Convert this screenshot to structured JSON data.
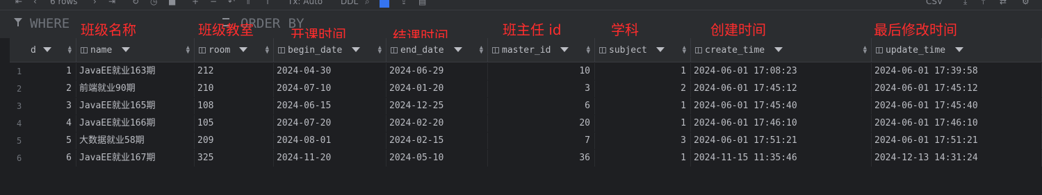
{
  "toolbar": {
    "rows_label": "6 rows",
    "mode_label": "Tx: Auto",
    "ddl_label": "DDL",
    "export_label": "CSV"
  },
  "filter": {
    "where_label": "WHERE",
    "order_label": "ORDER BY"
  },
  "annotations": [
    "班级名称",
    "班级教室",
    "开课时间",
    "结课时间",
    "班主任 id",
    "学科",
    "创建时间",
    "最后修改时间"
  ],
  "columns": [
    "d",
    "name",
    "room",
    "begin_date",
    "end_date",
    "master_id",
    "subject",
    "create_time",
    "update_time"
  ],
  "rows": [
    {
      "n": "1",
      "id": "1",
      "name": "JavaEE就业163期",
      "room": "212",
      "begin_date": "2024-04-30",
      "end_date": "2024-06-29",
      "master_id": "10",
      "subject": "1",
      "create_time": "2024-06-01 17:08:23",
      "update_time": "2024-06-01 17:39:58"
    },
    {
      "n": "2",
      "id": "2",
      "name": "前端就业90期",
      "room": "210",
      "begin_date": "2024-07-10",
      "end_date": "2024-01-20",
      "master_id": "3",
      "subject": "2",
      "create_time": "2024-06-01 17:45:12",
      "update_time": "2024-06-01 17:45:12"
    },
    {
      "n": "3",
      "id": "3",
      "name": "JavaEE就业165期",
      "room": "108",
      "begin_date": "2024-06-15",
      "end_date": "2024-12-25",
      "master_id": "6",
      "subject": "1",
      "create_time": "2024-06-01 17:45:40",
      "update_time": "2024-06-01 17:45:40"
    },
    {
      "n": "4",
      "id": "4",
      "name": "JavaEE就业166期",
      "room": "105",
      "begin_date": "2024-07-20",
      "end_date": "2024-02-20",
      "master_id": "20",
      "subject": "1",
      "create_time": "2024-06-01 17:46:10",
      "update_time": "2024-06-01 17:46:10"
    },
    {
      "n": "5",
      "id": "5",
      "name": "大数据就业58期",
      "room": "209",
      "begin_date": "2024-08-01",
      "end_date": "2024-02-15",
      "master_id": "7",
      "subject": "3",
      "create_time": "2024-06-01 17:51:21",
      "update_time": "2024-06-01 17:51:21"
    },
    {
      "n": "6",
      "id": "6",
      "name": "JavaEE就业167期",
      "room": "325",
      "begin_date": "2024-11-20",
      "end_date": "2024-05-10",
      "master_id": "36",
      "subject": "1",
      "create_time": "2024-11-15 11:35:46",
      "update_time": "2024-12-13 14:31:24"
    }
  ],
  "colors": {
    "annotation": "#ff2d2d",
    "background": "#1e1f22",
    "header": "#2b2d30",
    "selected_icon": "#3574f0"
  }
}
